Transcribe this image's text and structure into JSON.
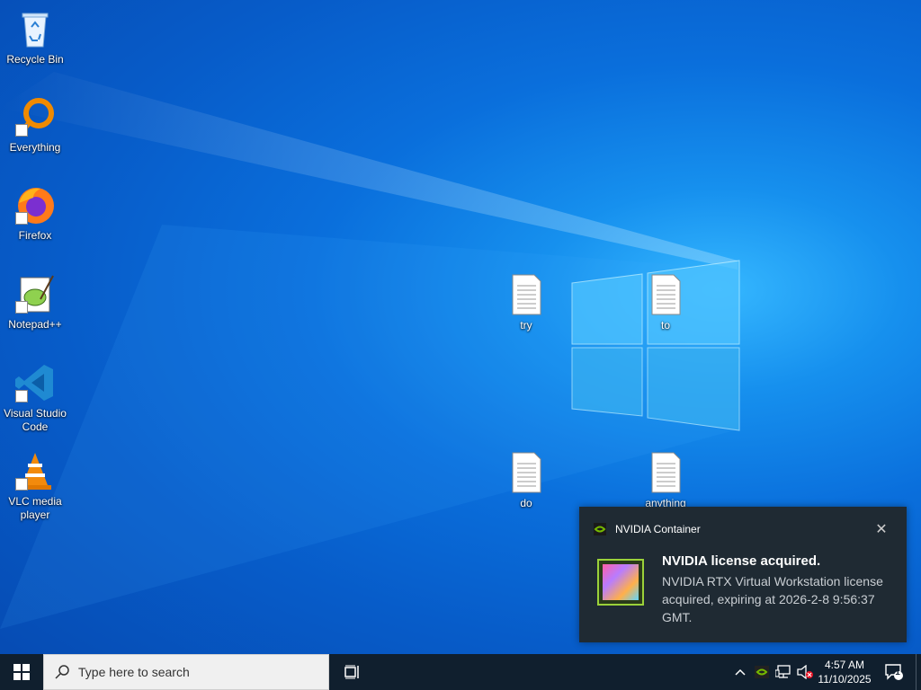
{
  "desktop": {
    "icons": [
      {
        "label": "Recycle Bin",
        "icon": "recycle-bin-icon"
      },
      {
        "label": "Everything",
        "icon": "everything-search-icon"
      },
      {
        "label": "Firefox",
        "icon": "firefox-icon"
      },
      {
        "label": "Notepad++",
        "icon": "notepadpp-icon"
      },
      {
        "label": "Visual Studio Code",
        "icon": "vscode-icon"
      },
      {
        "label": "VLC media player",
        "icon": "vlc-icon"
      }
    ],
    "files": [
      {
        "label": "try",
        "icon": "text-file-icon"
      },
      {
        "label": "to",
        "icon": "text-file-icon"
      },
      {
        "label": "do",
        "icon": "text-file-icon"
      },
      {
        "label": "anything",
        "icon": "text-file-icon"
      }
    ]
  },
  "notification": {
    "app_name": "NVIDIA Container",
    "title": "NVIDIA license acquired.",
    "body": "NVIDIA RTX Virtual Workstation license acquired, expiring at 2026-2-8 9:56:37 GMT.",
    "close": "✕"
  },
  "taskbar": {
    "search_placeholder": "Type here to search",
    "time": "4:57 AM",
    "date": "11/10/2025",
    "notification_count": "1"
  },
  "colors": {
    "taskbar": "#101f2e",
    "toast": "#1f2a33",
    "nvidia_green": "#76b900"
  }
}
